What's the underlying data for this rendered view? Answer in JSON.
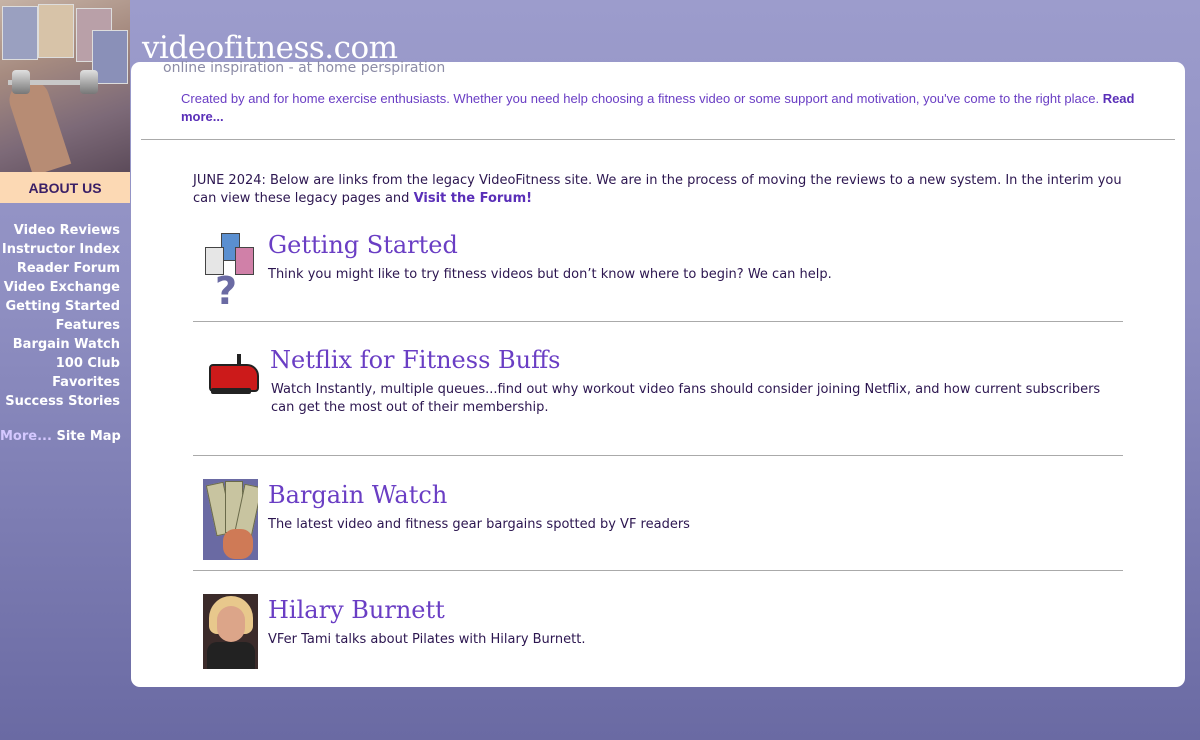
{
  "site": {
    "logo": "videofitness.com",
    "tagline": "online inspiration - at home perspiration"
  },
  "sidebar": {
    "about_label": "ABOUT US",
    "items": [
      {
        "label": "Video Reviews"
      },
      {
        "label": "Instructor Index"
      },
      {
        "label": "Reader Forum"
      },
      {
        "label": "Video Exchange"
      },
      {
        "label": "Getting Started"
      },
      {
        "label": "Features"
      },
      {
        "label": "Bargain Watch"
      },
      {
        "label": "100 Club"
      },
      {
        "label": "Favorites"
      },
      {
        "label": "Success Stories"
      }
    ],
    "more_label": "More...",
    "sitemap_label": "Site Map"
  },
  "intro": {
    "text": "Created by and for home exercise enthusiasts. Whether you need help choosing a fitness video or some support and motivation, you've come to the right place.",
    "read_more": "Read more..."
  },
  "notice": {
    "text": "JUNE 2024: Below are links from the legacy VideoFitness site. We are in the process of moving the reviews to a new system. In the interim you can view these legacy pages and",
    "link": "Visit the Forum!"
  },
  "items": [
    {
      "title": "Getting Started",
      "desc": "Think you might like to try fitness videos but don’t know where to begin? We can help."
    },
    {
      "title": "Netflix for Fitness Buffs",
      "desc": "Watch Instantly, multiple queues...find out why workout video fans should consider joining Netflix, and how current subscribers can get the most out of their membership."
    },
    {
      "title": "Bargain Watch",
      "desc": "The latest video and fitness gear bargains spotted by VF readers"
    },
    {
      "title": "Hilary Burnett",
      "desc": "VFer Tami talks about Pilates with Hilary Burnett."
    }
  ],
  "colors": {
    "accent": "#6a3ec4",
    "about_bg": "#fcd9b4",
    "sidebar_bg": "#8f8fc2"
  }
}
